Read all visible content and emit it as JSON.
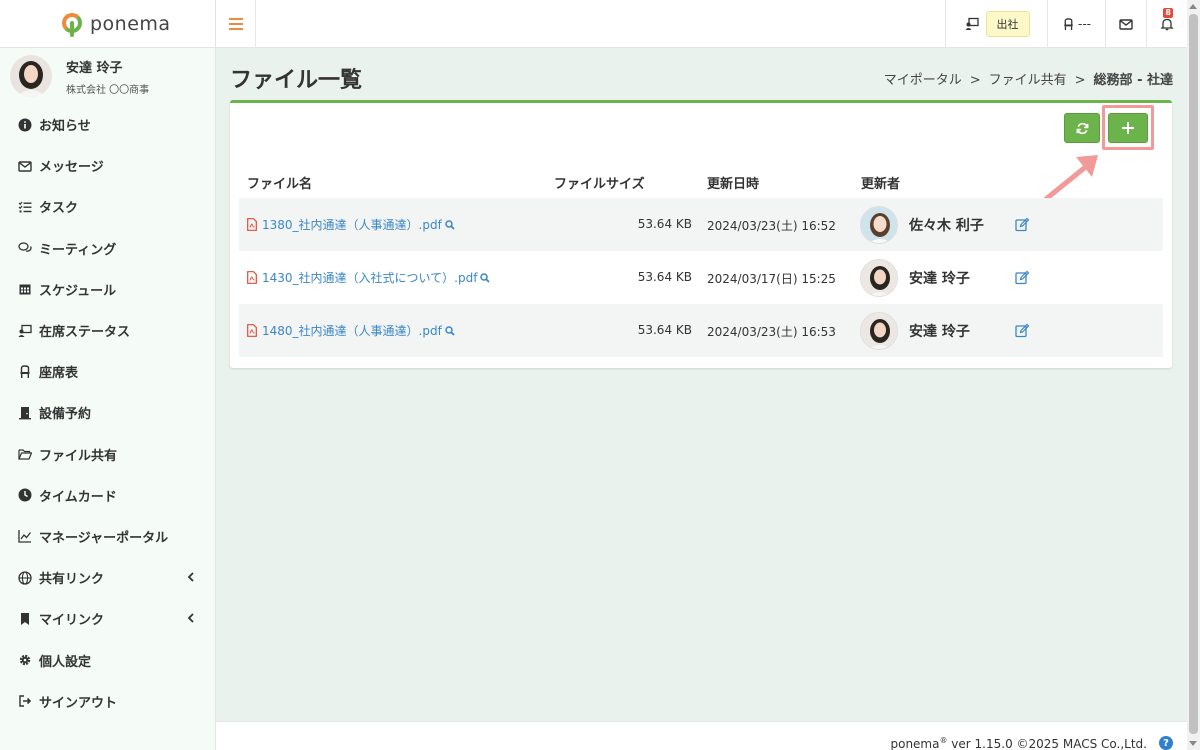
{
  "app": {
    "name": "ponema"
  },
  "user": {
    "name": "安達 玲子",
    "company": "株式会社 〇〇商事"
  },
  "sidebar": {
    "items": [
      {
        "label": "お知らせ",
        "icon": "info-icon"
      },
      {
        "label": "メッセージ",
        "icon": "envelope-icon"
      },
      {
        "label": "タスク",
        "icon": "tasks-icon"
      },
      {
        "label": "ミーティング",
        "icon": "comments-icon"
      },
      {
        "label": "スケジュール",
        "icon": "calendar-icon"
      },
      {
        "label": "在席ステータス",
        "icon": "presence-icon"
      },
      {
        "label": "座席表",
        "icon": "chair-icon"
      },
      {
        "label": "設備予約",
        "icon": "door-icon"
      },
      {
        "label": "ファイル共有",
        "icon": "folder-open-icon"
      },
      {
        "label": "タイムカード",
        "icon": "clock-icon"
      },
      {
        "label": "マネージャーポータル",
        "icon": "chart-line-icon"
      },
      {
        "label": "共有リンク",
        "icon": "globe-icon"
      },
      {
        "label": "マイリンク",
        "icon": "bookmark-icon"
      },
      {
        "label": "個人設定",
        "icon": "gear-icon"
      },
      {
        "label": "サインアウト",
        "icon": "sign-out-icon"
      }
    ]
  },
  "topbar": {
    "attendance_status": "出社",
    "seat": "---",
    "notification_count": "8"
  },
  "page": {
    "title": "ファイル一覧",
    "breadcrumb": [
      "マイポータル",
      "ファイル共有",
      "総務部 - 社達"
    ],
    "breadcrumb_sep": ">"
  },
  "table": {
    "headers": {
      "name": "ファイル名",
      "size": "ファイルサイズ",
      "updated_at": "更新日時",
      "updated_by": "更新者"
    },
    "rows": [
      {
        "name": "1380_社内通達（人事通達）.pdf",
        "size": "53.64 KB",
        "updated_at": "2024/03/23(土) 16:52",
        "updated_by": "佐々木 利子"
      },
      {
        "name": "1430_社内通達（入社式について）.pdf",
        "size": "53.64 KB",
        "updated_at": "2024/03/17(日) 15:25",
        "updated_by": "安達 玲子"
      },
      {
        "name": "1480_社内通達（人事通達）.pdf",
        "size": "53.64 KB",
        "updated_at": "2024/03/23(土) 16:53",
        "updated_by": "安達 玲子"
      }
    ]
  },
  "footer": {
    "brand": "ponema",
    "registered": "®",
    "version_text": " ver 1.15.0 ©2025 MACS Co.,Ltd.",
    "help": "?"
  },
  "colors": {
    "accent_green": "#6bb34a",
    "link_blue": "#3a86c8",
    "highlight_pink": "#f29a9a",
    "logo_orange": "#f08a3c"
  }
}
